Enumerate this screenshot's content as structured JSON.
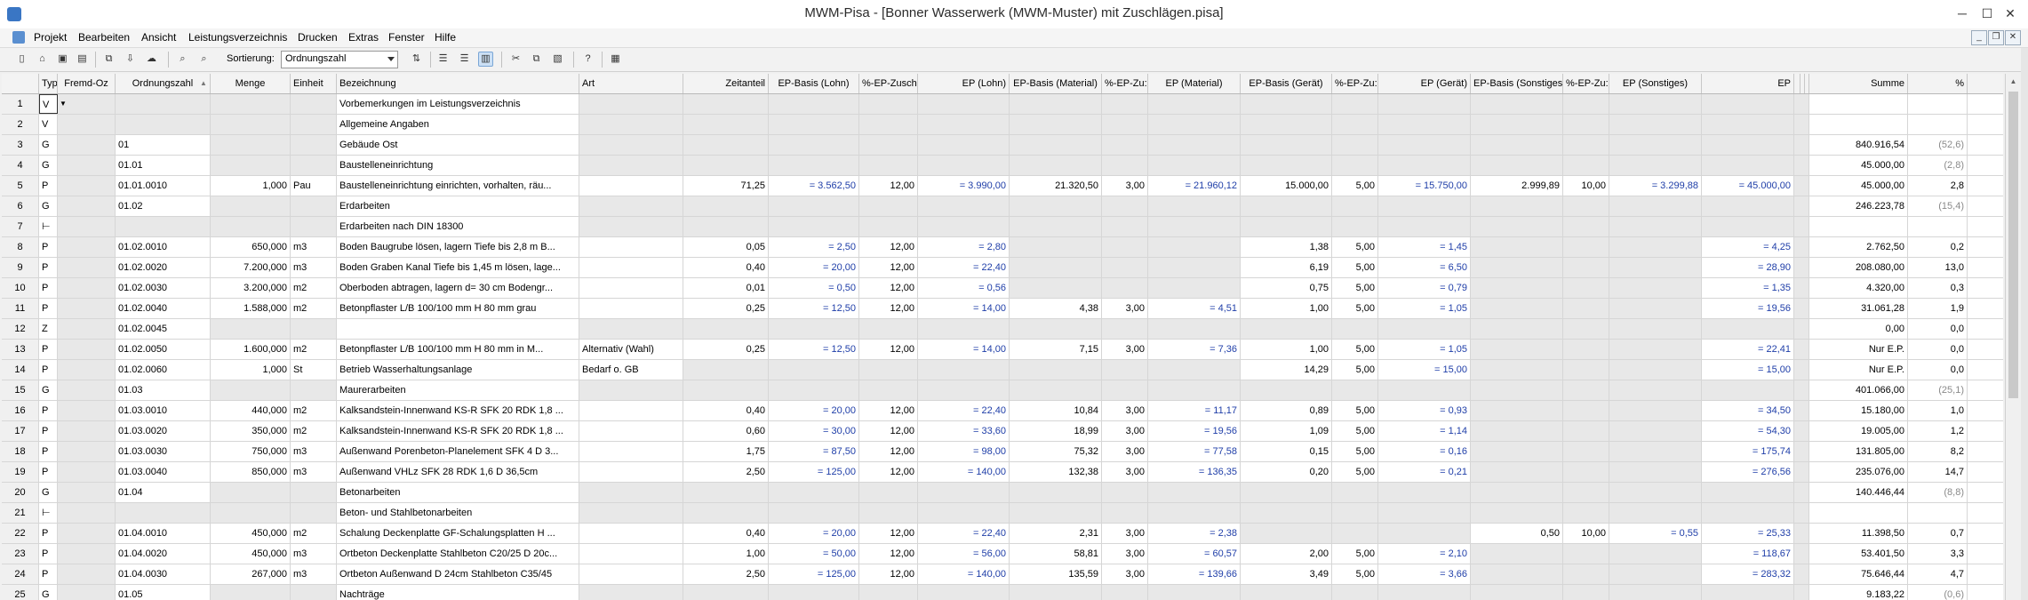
{
  "window": {
    "title": "MWM-Pisa - [Bonner Wasserwerk (MWM-Muster) mit Zuschlägen.pisa]",
    "minimize": "─",
    "maximize": "☐",
    "close": "✕"
  },
  "mdi": {
    "minimize": "_",
    "restore": "❐",
    "close": "✕"
  },
  "menu": [
    "Projekt",
    "Bearbeiten",
    "Ansicht",
    "Leistungsverzeichnis",
    "Drucken",
    "Extras",
    "Fenster",
    "Hilfe"
  ],
  "toolbar": {
    "sort_label": "Sortierung:",
    "sort_value": "Ordnungszahl",
    "icons": [
      "new-file-icon",
      "open-folder-icon",
      "save-icon",
      "export-icon",
      "copy-project-icon",
      "import-icon",
      "cloud-icon",
      "search-icon",
      "search-next-icon",
      "sort-options-icon",
      "list-numbered-icon",
      "list-outline-icon",
      "list-view-icon",
      "cut-icon",
      "copy-icon",
      "paste-icon",
      "help-icon",
      "calculator-icon"
    ]
  },
  "columns": [
    "",
    "Typ",
    "Fremd-Oz",
    "Ordnungszahl",
    "Menge",
    "Einheit",
    "Bezeichnung",
    "Art",
    "Zeitanteil",
    "EP-Basis (Lohn)",
    "%-EP-Zusch",
    "EP (Lohn)",
    "EP-Basis (Material)",
    "%-EP-Zu:",
    "EP (Material)",
    "EP-Basis (Gerät)",
    "%-EP-Zu:",
    "EP (Gerät)",
    "EP-Basis (Sonstiges)",
    "%-EP-Zu:",
    "EP (Sonstiges)",
    "EP",
    "",
    "",
    "",
    "Summe",
    "%"
  ],
  "rows": [
    [
      "1",
      "V",
      "",
      "",
      "",
      "",
      "Vorbemerkungen im Leistungsverzeichnis",
      "",
      "",
      "",
      "",
      "",
      "",
      "",
      "",
      "",
      "",
      "",
      "",
      "",
      "",
      "",
      "",
      "",
      "",
      "",
      ""
    ],
    [
      "2",
      "V",
      "",
      "",
      "",
      "",
      "Allgemeine Angaben",
      "",
      "",
      "",
      "",
      "",
      "",
      "",
      "",
      "",
      "",
      "",
      "",
      "",
      "",
      "",
      "",
      "",
      "",
      "",
      ""
    ],
    [
      "3",
      "G",
      "",
      "01",
      "",
      "",
      "Gebäude Ost",
      "",
      "",
      "",
      "",
      "",
      "",
      "",
      "",
      "",
      "",
      "",
      "",
      "",
      "",
      "",
      "",
      "",
      "",
      "840.916,54",
      "(52,6)"
    ],
    [
      "4",
      "G",
      "",
      "01.01",
      "",
      "",
      "Baustelleneinrichtung",
      "",
      "",
      "",
      "",
      "",
      "",
      "",
      "",
      "",
      "",
      "",
      "",
      "",
      "",
      "",
      "",
      "",
      "",
      "45.000,00",
      "(2,8)"
    ],
    [
      "5",
      "P",
      "",
      "01.01.0010",
      "1,000",
      "Pau",
      "Baustelleneinrichtung einrichten, vorhalten, räu...",
      "",
      "71,25",
      "= 3.562,50",
      "12,00",
      "= 3.990,00",
      "21.320,50",
      "3,00",
      "= 21.960,12",
      "15.000,00",
      "5,00",
      "= 15.750,00",
      "2.999,89",
      "10,00",
      "= 3.299,88",
      "= 45.000,00",
      "",
      "",
      "",
      "45.000,00",
      "2,8"
    ],
    [
      "6",
      "G",
      "",
      "01.02",
      "",
      "",
      "Erdarbeiten",
      "",
      "",
      "",
      "",
      "",
      "",
      "",
      "",
      "",
      "",
      "",
      "",
      "",
      "",
      "",
      "",
      "",
      "",
      "246.223,78",
      "(15,4)"
    ],
    [
      "7",
      "⊢",
      "",
      "",
      "",
      "",
      "Erdarbeiten nach DIN 18300",
      "",
      "",
      "",
      "",
      "",
      "",
      "",
      "",
      "",
      "",
      "",
      "",
      "",
      "",
      "",
      "",
      "",
      "",
      "",
      ""
    ],
    [
      "8",
      "P",
      "",
      "01.02.0010",
      "650,000",
      "m3",
      "Boden Baugrube lösen, lagern Tiefe bis 2,8 m B...",
      "",
      "0,05",
      "= 2,50",
      "12,00",
      "= 2,80",
      "",
      "",
      "",
      "1,38",
      "5,00",
      "= 1,45",
      "",
      "",
      "",
      "= 4,25",
      "",
      "",
      "",
      "2.762,50",
      "0,2"
    ],
    [
      "9",
      "P",
      "",
      "01.02.0020",
      "7.200,000",
      "m3",
      "Boden Graben Kanal Tiefe bis 1,45 m lösen, lage...",
      "",
      "0,40",
      "= 20,00",
      "12,00",
      "= 22,40",
      "",
      "",
      "",
      "6,19",
      "5,00",
      "= 6,50",
      "",
      "",
      "",
      "= 28,90",
      "",
      "",
      "",
      "208.080,00",
      "13,0"
    ],
    [
      "10",
      "P",
      "",
      "01.02.0030",
      "3.200,000",
      "m2",
      "Oberboden abtragen, lagern d= 30 cm Bodengr...",
      "",
      "0,01",
      "= 0,50",
      "12,00",
      "= 0,56",
      "",
      "",
      "",
      "0,75",
      "5,00",
      "= 0,79",
      "",
      "",
      "",
      "= 1,35",
      "",
      "",
      "",
      "4.320,00",
      "0,3"
    ],
    [
      "11",
      "P",
      "",
      "01.02.0040",
      "1.588,000",
      "m2",
      "Betonpflaster L/B 100/100 mm H 80 mm  grau",
      "",
      "0,25",
      "= 12,50",
      "12,00",
      "= 14,00",
      "4,38",
      "3,00",
      "= 4,51",
      "1,00",
      "5,00",
      "= 1,05",
      "",
      "",
      "",
      "= 19,56",
      "",
      "",
      "",
      "31.061,28",
      "1,9"
    ],
    [
      "12",
      "Z",
      "",
      "01.02.0045",
      "",
      "",
      "",
      "",
      "",
      "",
      "",
      "",
      "",
      "",
      "",
      "",
      "",
      "",
      "",
      "",
      "",
      "",
      "",
      "",
      "",
      "0,00",
      "0,0"
    ],
    [
      "13",
      "P",
      "",
      "01.02.0050",
      "1.600,000",
      "m2",
      "Betonpflaster L/B 100/100 mm H 80 mm  in M...",
      "Alternativ (Wahl)",
      "0,25",
      "= 12,50",
      "12,00",
      "= 14,00",
      "7,15",
      "3,00",
      "= 7,36",
      "1,00",
      "5,00",
      "= 1,05",
      "",
      "",
      "",
      "= 22,41",
      "",
      "",
      "",
      "Nur E.P.",
      "0,0"
    ],
    [
      "14",
      "P",
      "",
      "01.02.0060",
      "1,000",
      "St",
      "Betrieb Wasserhaltungsanlage",
      "Bedarf o. GB",
      "",
      "",
      "",
      "",
      "",
      "",
      "",
      "14,29",
      "5,00",
      "= 15,00",
      "",
      "",
      "",
      "= 15,00",
      "",
      "",
      "",
      "Nur E.P.",
      "0,0"
    ],
    [
      "15",
      "G",
      "",
      "01.03",
      "",
      "",
      "Maurerarbeiten",
      "",
      "",
      "",
      "",
      "",
      "",
      "",
      "",
      "",
      "",
      "",
      "",
      "",
      "",
      "",
      "",
      "",
      "",
      "401.066,00",
      "(25,1)"
    ],
    [
      "16",
      "P",
      "",
      "01.03.0010",
      "440,000",
      "m2",
      "Kalksandstein-Innenwand KS-R SFK 20 RDK 1,8 ...",
      "",
      "0,40",
      "= 20,00",
      "12,00",
      "= 22,40",
      "10,84",
      "3,00",
      "= 11,17",
      "0,89",
      "5,00",
      "= 0,93",
      "",
      "",
      "",
      "= 34,50",
      "",
      "",
      "",
      "15.180,00",
      "1,0"
    ],
    [
      "17",
      "P",
      "",
      "01.03.0020",
      "350,000",
      "m2",
      "Kalksandstein-Innenwand KS-R SFK 20 RDK 1,8 ...",
      "",
      "0,60",
      "= 30,00",
      "12,00",
      "= 33,60",
      "18,99",
      "3,00",
      "= 19,56",
      "1,09",
      "5,00",
      "= 1,14",
      "",
      "",
      "",
      "= 54,30",
      "",
      "",
      "",
      "19.005,00",
      "1,2"
    ],
    [
      "18",
      "P",
      "",
      "01.03.0030",
      "750,000",
      "m3",
      "Außenwand Porenbeton-Planelement SFK 4 D 3...",
      "",
      "1,75",
      "= 87,50",
      "12,00",
      "= 98,00",
      "75,32",
      "3,00",
      "= 77,58",
      "0,15",
      "5,00",
      "= 0,16",
      "",
      "",
      "",
      "= 175,74",
      "",
      "",
      "",
      "131.805,00",
      "8,2"
    ],
    [
      "19",
      "P",
      "",
      "01.03.0040",
      "850,000",
      "m3",
      "Außenwand VHLz SFK 28 RDK 1,6 D 36,5cm",
      "",
      "2,50",
      "= 125,00",
      "12,00",
      "= 140,00",
      "132,38",
      "3,00",
      "= 136,35",
      "0,20",
      "5,00",
      "= 0,21",
      "",
      "",
      "",
      "= 276,56",
      "",
      "",
      "",
      "235.076,00",
      "14,7"
    ],
    [
      "20",
      "G",
      "",
      "01.04",
      "",
      "",
      "Betonarbeiten",
      "",
      "",
      "",
      "",
      "",
      "",
      "",
      "",
      "",
      "",
      "",
      "",
      "",
      "",
      "",
      "",
      "",
      "",
      "140.446,44",
      "(8,8)"
    ],
    [
      "21",
      "⊢",
      "",
      "",
      "",
      "",
      "Beton- und Stahlbetonarbeiten",
      "",
      "",
      "",
      "",
      "",
      "",
      "",
      "",
      "",
      "",
      "",
      "",
      "",
      "",
      "",
      "",
      "",
      "",
      "",
      ""
    ],
    [
      "22",
      "P",
      "",
      "01.04.0010",
      "450,000",
      "m2",
      "Schalung Deckenplatte GF-Schalungsplatten H ...",
      "",
      "0,40",
      "= 20,00",
      "12,00",
      "= 22,40",
      "2,31",
      "3,00",
      "= 2,38",
      "",
      "",
      "",
      "0,50",
      "10,00",
      "= 0,55",
      "= 25,33",
      "",
      "",
      "",
      "11.398,50",
      "0,7"
    ],
    [
      "23",
      "P",
      "",
      "01.04.0020",
      "450,000",
      "m3",
      "Ortbeton Deckenplatte Stahlbeton C20/25 D 20c...",
      "",
      "1,00",
      "= 50,00",
      "12,00",
      "= 56,00",
      "58,81",
      "3,00",
      "= 60,57",
      "2,00",
      "5,00",
      "= 2,10",
      "",
      "",
      "",
      "= 118,67",
      "",
      "",
      "",
      "53.401,50",
      "3,3"
    ],
    [
      "24",
      "P",
      "",
      "01.04.0030",
      "267,000",
      "m3",
      "Ortbeton Außenwand D 24cm Stahlbeton C35/45",
      "",
      "2,50",
      "= 125,00",
      "12,00",
      "= 140,00",
      "135,59",
      "3,00",
      "= 139,66",
      "3,49",
      "5,00",
      "= 3,66",
      "",
      "",
      "",
      "= 283,32",
      "",
      "",
      "",
      "75.646,44",
      "4,7"
    ],
    [
      "25",
      "G",
      "",
      "01.05",
      "",
      "",
      "Nachträge",
      "",
      "",
      "",
      "",
      "",
      "",
      "",
      "",
      "",
      "",
      "",
      "",
      "",
      "",
      "",
      "",
      "",
      "",
      "9.183,22",
      "(0,6)"
    ]
  ]
}
